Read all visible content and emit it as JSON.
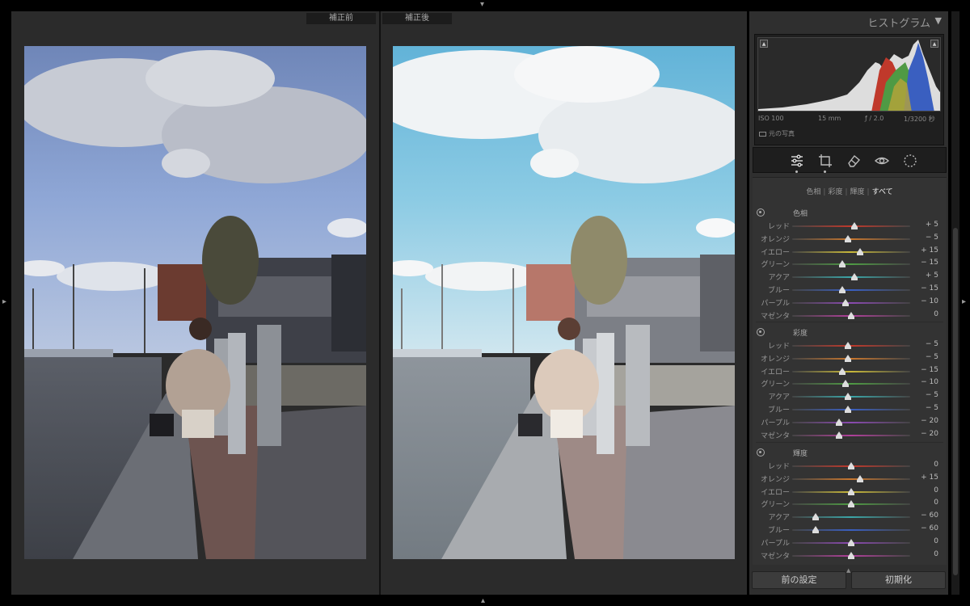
{
  "compare": {
    "before_label": "補正前",
    "after_label": "補正後"
  },
  "histogram": {
    "title": "ヒストグラム",
    "toggle_icon": "triangle-down-icon",
    "exif": {
      "iso": "ISO 100",
      "focal": "15 mm",
      "aperture": "ƒ / 2.0",
      "shutter": "1/3200 秒"
    },
    "original_photo": "元の写真"
  },
  "tools": [
    "sliders-icon",
    "crop-icon",
    "eraser-icon",
    "redeye-icon",
    "radial-icon"
  ],
  "hsl": {
    "tabs": [
      {
        "label": "色相",
        "active": false
      },
      {
        "label": "彩度",
        "active": false
      },
      {
        "label": "輝度",
        "active": false
      },
      {
        "label": "すべて",
        "active": true
      }
    ],
    "sections": [
      {
        "title": "色相",
        "rows": [
          {
            "label": "レッド",
            "value": "+ 5",
            "num": 5
          },
          {
            "label": "オレンジ",
            "value": "− 5",
            "num": -5
          },
          {
            "label": "イエロー",
            "value": "+ 15",
            "num": 15
          },
          {
            "label": "グリーン",
            "value": "− 15",
            "num": -15
          },
          {
            "label": "アクア",
            "value": "+ 5",
            "num": 5
          },
          {
            "label": "ブルー",
            "value": "− 15",
            "num": -15
          },
          {
            "label": "パープル",
            "value": "− 10",
            "num": -10
          },
          {
            "label": "マゼンタ",
            "value": "0",
            "num": 0
          }
        ]
      },
      {
        "title": "彩度",
        "rows": [
          {
            "label": "レッド",
            "value": "− 5",
            "num": -5
          },
          {
            "label": "オレンジ",
            "value": "− 5",
            "num": -5
          },
          {
            "label": "イエロー",
            "value": "− 15",
            "num": -15
          },
          {
            "label": "グリーン",
            "value": "− 10",
            "num": -10
          },
          {
            "label": "アクア",
            "value": "− 5",
            "num": -5
          },
          {
            "label": "ブルー",
            "value": "− 5",
            "num": -5
          },
          {
            "label": "パープル",
            "value": "− 20",
            "num": -20
          },
          {
            "label": "マゼンタ",
            "value": "− 20",
            "num": -20
          }
        ]
      },
      {
        "title": "輝度",
        "rows": [
          {
            "label": "レッド",
            "value": "0",
            "num": 0
          },
          {
            "label": "オレンジ",
            "value": "+ 15",
            "num": 15
          },
          {
            "label": "イエロー",
            "value": "0",
            "num": 0
          },
          {
            "label": "グリーン",
            "value": "0",
            "num": 0
          },
          {
            "label": "アクア",
            "value": "− 60",
            "num": -60
          },
          {
            "label": "ブルー",
            "value": "− 60",
            "num": -60
          },
          {
            "label": "パープル",
            "value": "0",
            "num": 0
          },
          {
            "label": "マゼンタ",
            "value": "0",
            "num": 0
          }
        ]
      }
    ]
  },
  "buttons": {
    "previous": "前の設定",
    "reset": "初期化"
  },
  "colors": {
    "red": "#c0392b",
    "orange": "#c9772e",
    "yellow": "#c8b83a",
    "green": "#4f9a44",
    "aqua": "#3ba6a8",
    "blue": "#3a5fc0",
    "purple": "#8a4ab0",
    "magenta": "#b0409a"
  }
}
